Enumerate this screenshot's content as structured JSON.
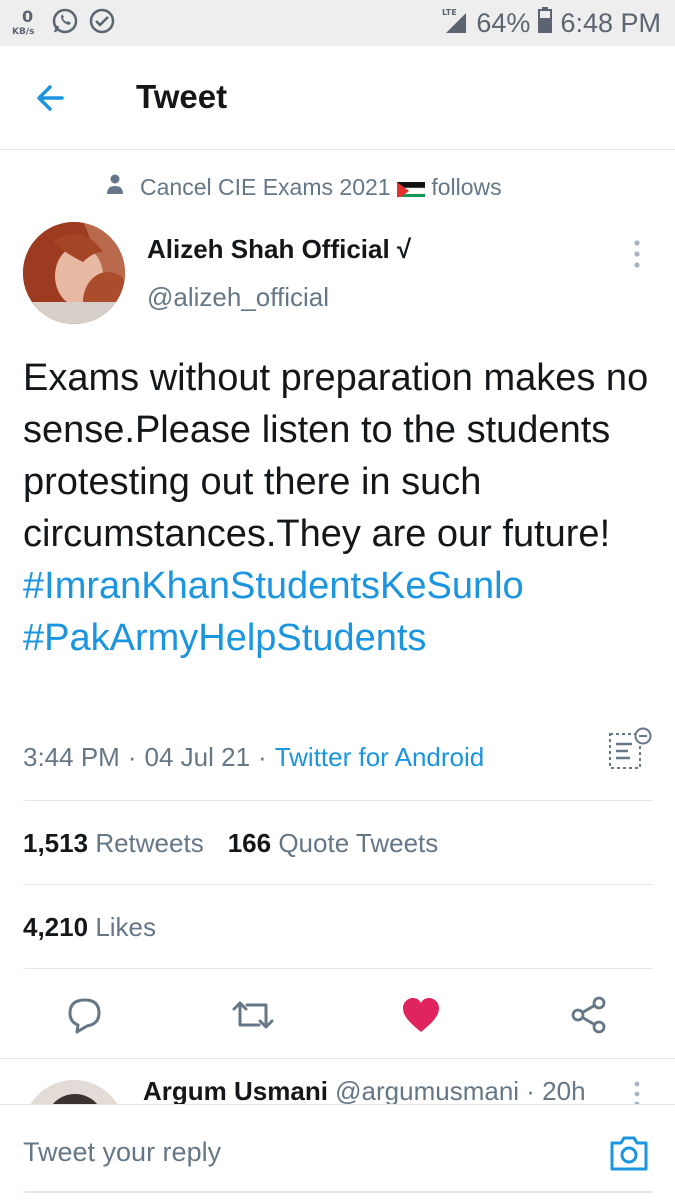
{
  "status_bar": {
    "net_speed": "0",
    "net_unit": "KB/s",
    "network": "LTE",
    "battery": "64%",
    "time": "6:48 PM"
  },
  "header": {
    "title": "Tweet"
  },
  "social_context": {
    "text": "Cancel CIE Exams 2021",
    "suffix": "follows"
  },
  "author": {
    "name": "Alizeh Shah Official √",
    "handle": "@alizeh_official"
  },
  "tweet": {
    "text": "Exams without preparation makes no sense.Please listen to the students protesting out there in such circumstances.They are our future!",
    "hashtags": [
      "#ImranKhanStudentsKeSunlo",
      "#PakArmyHelpStudents"
    ],
    "time": "3:44 PM",
    "date": "04 Jul 21",
    "source": "Twitter for Android",
    "separator": "·"
  },
  "stats": {
    "retweets_count": "1,513",
    "retweets_label": "Retweets",
    "quotes_count": "166",
    "quotes_label": "Quote Tweets",
    "likes_count": "4,210",
    "likes_label": "Likes"
  },
  "reply_preview": {
    "name": "Argum Usmani",
    "handle": "@argumusmani",
    "time": "· 20h"
  },
  "composer": {
    "placeholder": "Tweet your reply"
  },
  "colors": {
    "accent": "#1b95e0",
    "like": "#e0245e",
    "muted": "#657786",
    "text": "#14171a",
    "divider": "#e1e8ed"
  },
  "icons": [
    "back-arrow-icon",
    "person-icon",
    "more-vertical-icon",
    "translate-icon",
    "reply-icon",
    "retweet-icon",
    "heart-icon",
    "share-icon",
    "camera-icon"
  ]
}
